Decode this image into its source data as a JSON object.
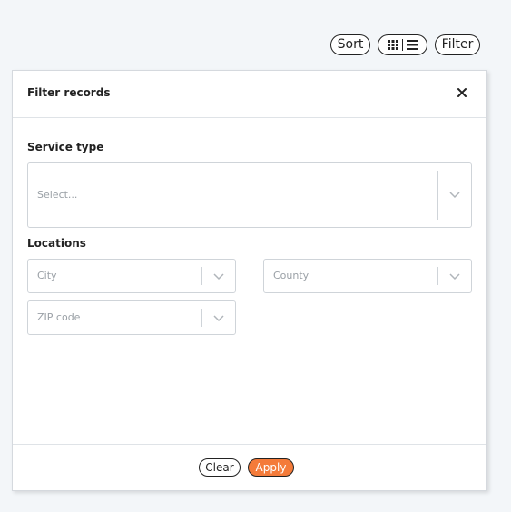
{
  "toolbar": {
    "sort_label": "Sort",
    "filter_label": "Filter",
    "view_toggle_icons": [
      "grid-icon",
      "list-icon"
    ]
  },
  "modal": {
    "title": "Filter records",
    "close_icon": "close-icon",
    "service_type": {
      "label": "Service type",
      "placeholder": "Select..."
    },
    "locations": {
      "label": "Locations",
      "city_placeholder": "City",
      "county_placeholder": "County",
      "zip_placeholder": "ZIP code"
    },
    "footer": {
      "clear_label": "Clear",
      "apply_label": "Apply"
    }
  },
  "colors": {
    "accent": "#f47b3a",
    "page_background": "#f3f6f9",
    "border": "#cfd4d9"
  }
}
